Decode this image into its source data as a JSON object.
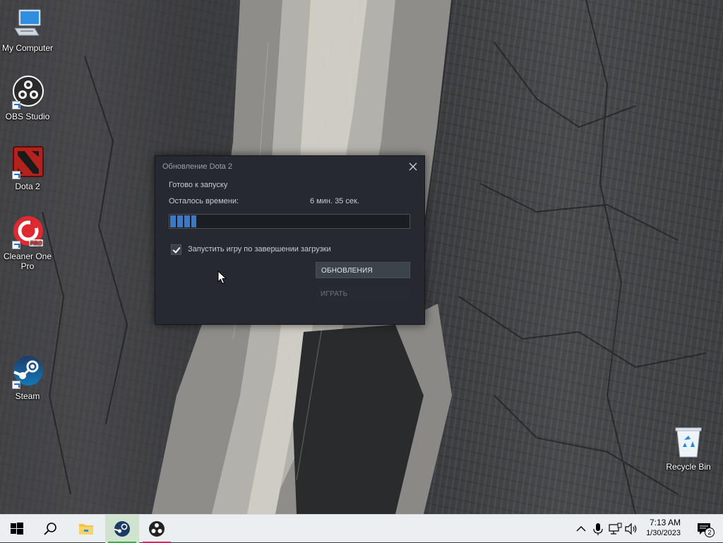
{
  "desktop": {
    "icons": [
      {
        "label": "My Computer",
        "icon": "computer-icon"
      },
      {
        "label": "OBS Studio",
        "icon": "obs-icon"
      },
      {
        "label": "Dota 2",
        "icon": "dota2-icon"
      },
      {
        "label": "Cleaner One Pro",
        "icon": "cleaner-one-pro-icon",
        "badge": "PRO"
      },
      {
        "label": "Steam",
        "icon": "steam-icon"
      },
      {
        "label": "Recycle Bin",
        "icon": "recycle-bin-icon"
      }
    ]
  },
  "dialog": {
    "title": "Обновление Dota 2",
    "status": "Готово к запуску",
    "remaining_label": "Осталось времени:",
    "remaining_value": "6 мин. 35 сек.",
    "progress_fraction": 0.11,
    "launch_checkbox": {
      "label": "Запустить игру по завершении загрузки",
      "checked": true
    },
    "updates_button": "ОБНОВЛЕНИЯ",
    "play_button": "ИГРАТЬ",
    "accent_color": "#3b79c6"
  },
  "taskbar": {
    "items": [
      "windows-start-icon",
      "search-icon",
      "file-explorer-icon",
      "steam-icon",
      "obs-icon"
    ],
    "active_item": "steam",
    "tray": [
      "chevron-up-icon",
      "microphone-icon",
      "network-icon",
      "volume-icon"
    ],
    "time": "7:13 AM",
    "date": "1/30/2023",
    "notification_count": "2"
  }
}
